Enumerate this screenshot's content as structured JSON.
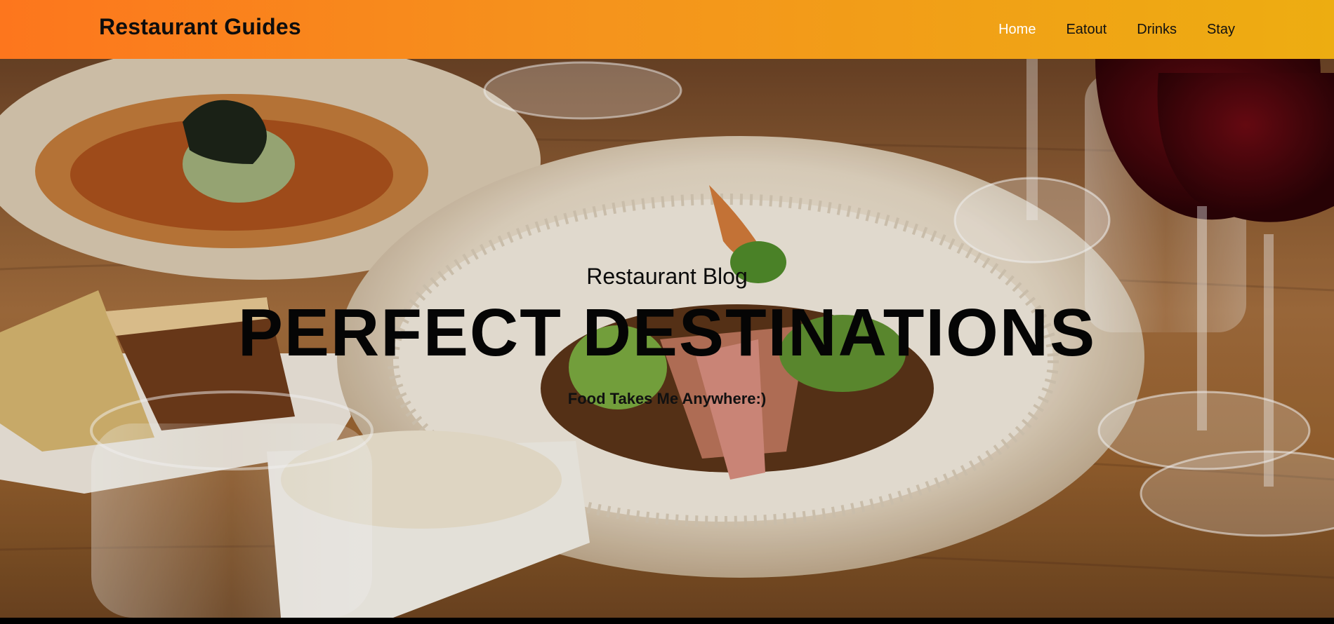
{
  "navbar": {
    "brand": "Restaurant Guides",
    "links": [
      {
        "label": "Home",
        "active": true
      },
      {
        "label": "Eatout",
        "active": false
      },
      {
        "label": "Drinks",
        "active": false
      },
      {
        "label": "Stay",
        "active": false
      }
    ],
    "gradient": [
      "#fd761d",
      "#edad11"
    ],
    "active_color": "#ffffff"
  },
  "hero": {
    "kicker": "Restaurant Blog",
    "title": "PERFECT DESTINATIONS",
    "tagline": "Food Takes Me Anywhere:)"
  }
}
